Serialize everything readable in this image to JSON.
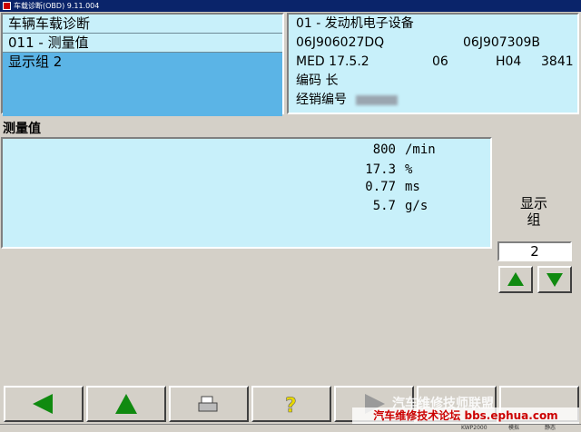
{
  "window": {
    "title": "车载诊断(OBD) 9.11.004"
  },
  "left": {
    "title": "车辆车载诊断",
    "function": "011 - 测量值",
    "selected": "显示组 2"
  },
  "right": {
    "line1": "01 - 发动机电子设备",
    "part_no_1": "06J906027DQ",
    "part_no_2": "06J907309B",
    "software": "MED 17.5.2",
    "version": "06",
    "hw": "H04",
    "code": "3841",
    "coding_label": "编码 长",
    "dealer_label": "经销编号"
  },
  "measure": {
    "label": "测量值",
    "rows": [
      {
        "value": "800",
        "unit": "/min"
      },
      {
        "value": "17.3",
        "unit": "%"
      },
      {
        "value": "0.77",
        "unit": "ms"
      },
      {
        "value": "5.7",
        "unit": "g/s"
      }
    ]
  },
  "group": {
    "label_line1": "显示",
    "label_line2": "组",
    "value": "2"
  },
  "watermark": {
    "top": "汽车维修技师联盟",
    "bottom": "汽车维修技术论坛 bbs.ephua.com"
  },
  "status": {
    "left": "KWP2000",
    "mid": "模拟",
    "right": "静态"
  },
  "colors": {
    "panel": "#c8f0fa",
    "selected": "#5bb4e6",
    "arrow_green": "#108a10",
    "help_yellow": "#e8d800"
  }
}
